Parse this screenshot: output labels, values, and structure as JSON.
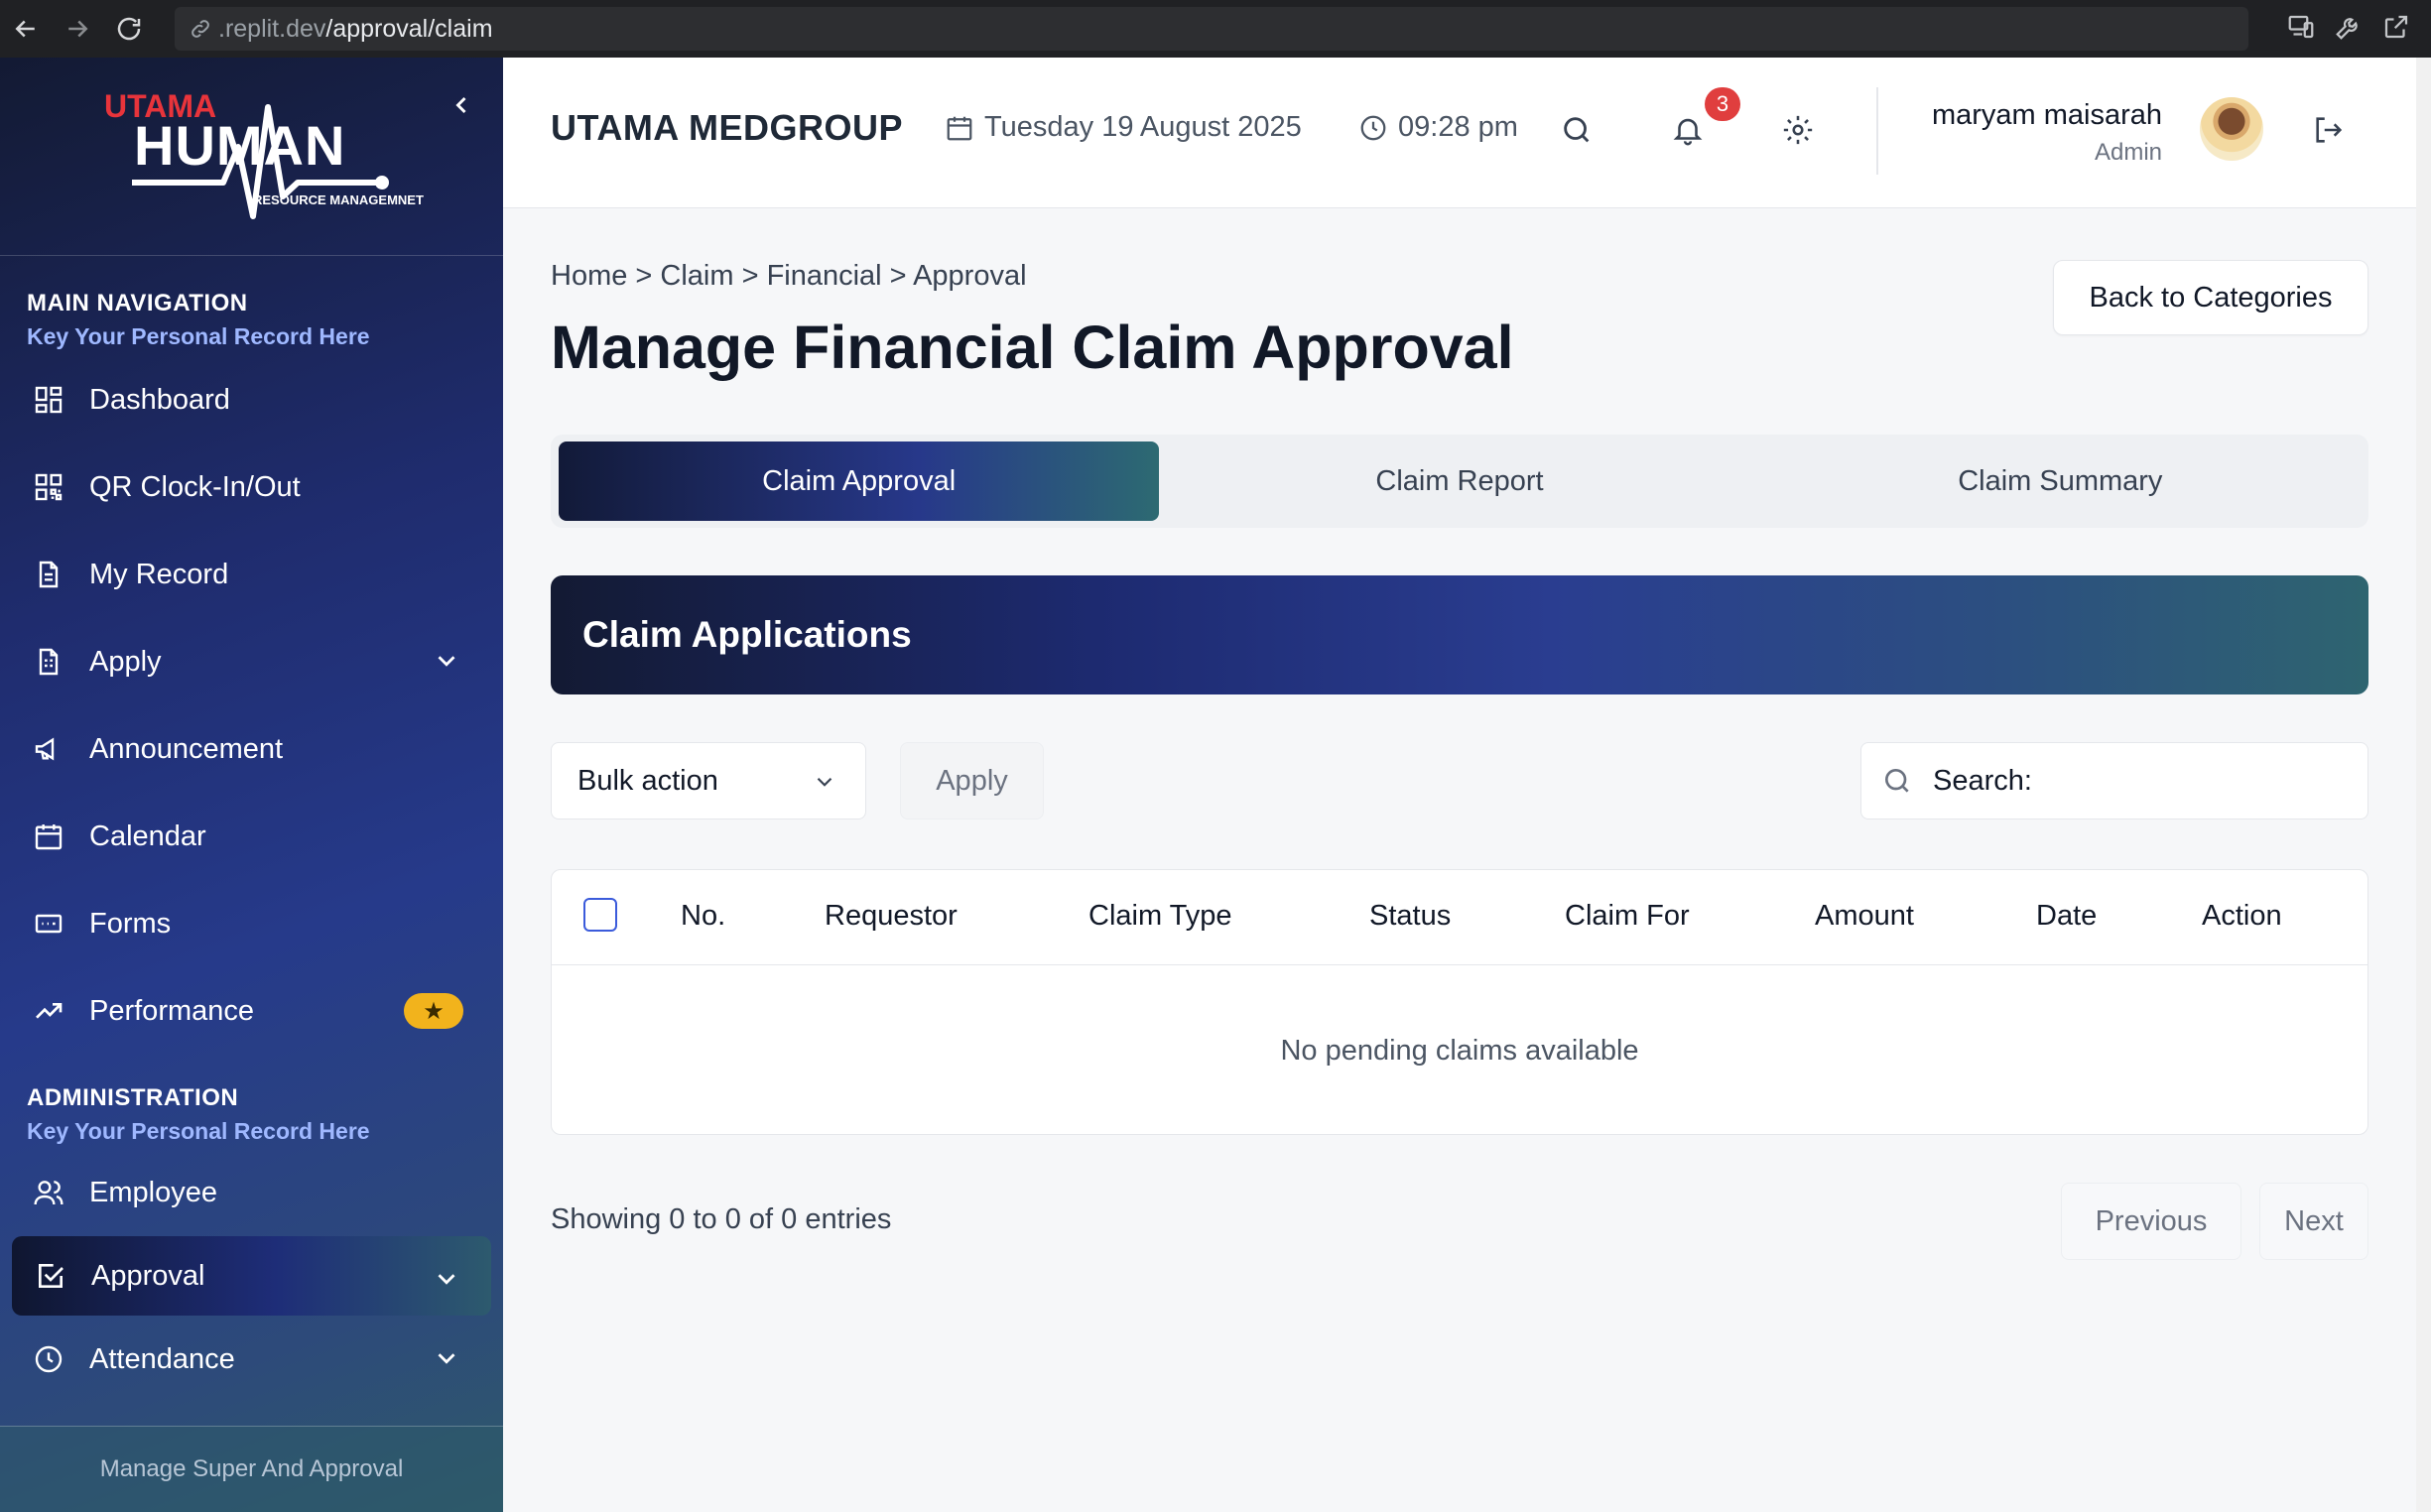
{
  "browser": {
    "url_prefix": ".replit.dev",
    "url_path": "/approval/claim"
  },
  "sidebar": {
    "logo_text_top": "UTAMA",
    "logo_text_main": "HUMAN",
    "logo_text_sub": "RESOURCE MANAGEMNET",
    "main_title": "MAIN NAVIGATION",
    "main_subtitle": "Key Your Personal Record Here",
    "items": [
      {
        "label": "Dashboard",
        "icon": "dashboard-icon"
      },
      {
        "label": "QR Clock-In/Out",
        "icon": "qr-code-icon"
      },
      {
        "label": "My Record",
        "icon": "document-icon"
      },
      {
        "label": "Apply",
        "icon": "form-icon"
      },
      {
        "label": "Announcement",
        "icon": "megaphone-icon"
      },
      {
        "label": "Calendar",
        "icon": "calendar-icon"
      },
      {
        "label": "Forms",
        "icon": "forms-icon"
      },
      {
        "label": "Performance",
        "icon": "trending-up-icon"
      }
    ],
    "admin_title": "ADMINISTRATION",
    "admin_subtitle": "Key Your Personal Record Here",
    "admin_items": [
      {
        "label": "Employee",
        "icon": "users-icon"
      },
      {
        "label": "Approval",
        "icon": "check-square-icon"
      },
      {
        "label": "Attendance",
        "icon": "clock-icon"
      }
    ],
    "footer": "Manage Super And Approval",
    "performance_badge": "★"
  },
  "header": {
    "brand": "UTAMA MEDGROUP",
    "date": "Tuesday 19 August 2025",
    "time": "09:28 pm",
    "notifications": "3",
    "user_name": "maryam maisarah",
    "user_role": "Admin"
  },
  "main": {
    "breadcrumb": "Home > Claim > Financial > Approval",
    "title": "Manage Financial Claim Approval",
    "back_button": "Back to Categories",
    "tabs": [
      "Claim Approval",
      "Claim Report",
      "Claim Summary"
    ],
    "card_title": "Claim Applications",
    "bulk_action": "Bulk action",
    "apply_button": "Apply",
    "search_placeholder": "Search:",
    "columns": [
      "No.",
      "Requestor",
      "Claim Type",
      "Status",
      "Claim For",
      "Amount",
      "Date",
      "Action"
    ],
    "empty_message": "No pending claims available",
    "showing": "Showing 0 to 0 of 0 entries",
    "previous": "Previous",
    "next": "Next"
  },
  "colors": {
    "accent": "#27388a",
    "sidebar_dark": "#131a33",
    "badge_red": "#e03e3e",
    "star_yellow": "#f2b31c"
  }
}
